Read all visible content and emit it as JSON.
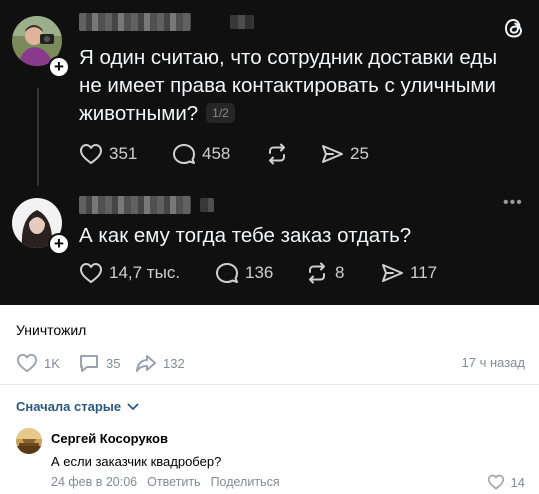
{
  "threads": {
    "post1": {
      "text_line1": "Я один считаю, что сотрудник доставки еды",
      "text_line2": "не имеет права контактировать с уличными",
      "text_line3": "животными?",
      "pager": "1/2",
      "likes": "351",
      "replies": "458",
      "reposts": "",
      "shares": "25"
    },
    "post2": {
      "text": "А как ему тогда тебе заказ отдать?",
      "likes": "14,7 тыс.",
      "replies": "136",
      "reposts": "8",
      "shares": "117"
    }
  },
  "post": {
    "caption": "Уничтожил",
    "likes": "1K",
    "comments": "35",
    "shares": "132",
    "time": "17 ч назад"
  },
  "comments": {
    "sort_label": "Сначала старые",
    "items": [
      {
        "author": "Сергей Косоруков",
        "text": "А если заказчик квадробер?",
        "date": "24 фев в 20:06",
        "reply_label": "Ответить",
        "share_label": "Поделиться",
        "likes": "14"
      }
    ]
  },
  "colors": {
    "threads_bg": "#101010",
    "vk_link": "#2a5885",
    "vk_muted": "#818c99"
  }
}
